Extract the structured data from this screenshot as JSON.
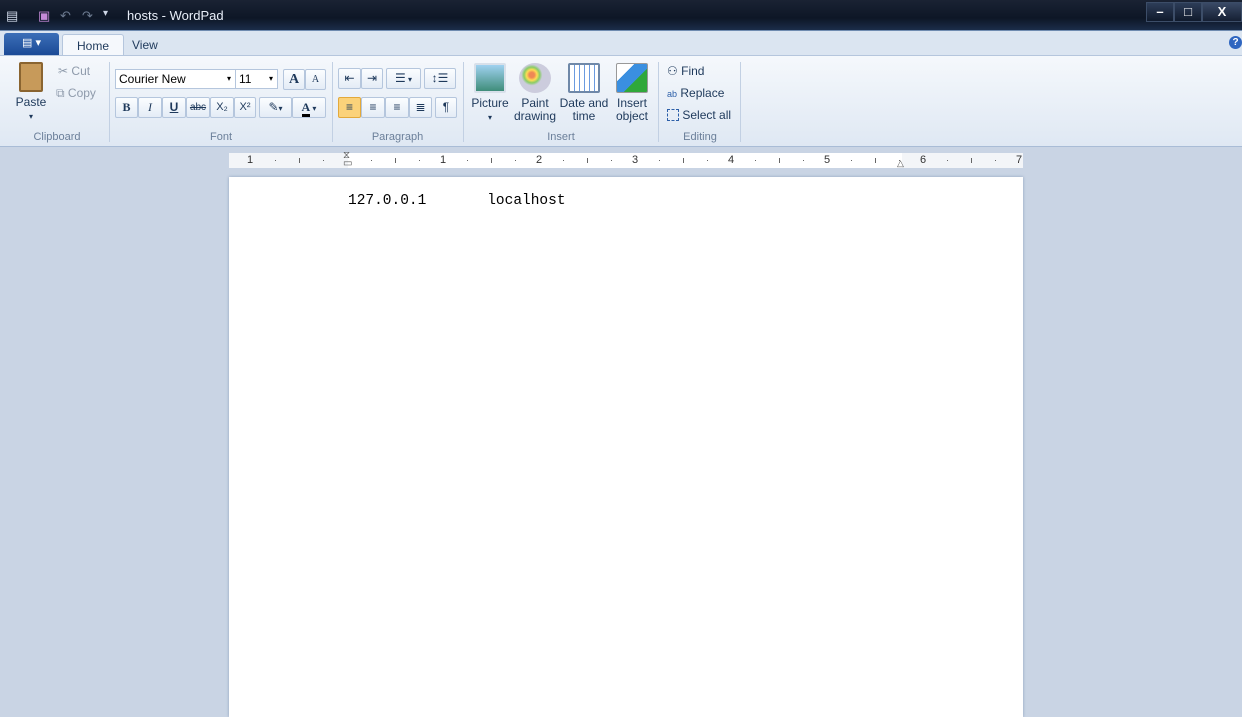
{
  "window": {
    "title": "hosts - WordPad",
    "minimize": "–",
    "maximize": "□",
    "close": "X"
  },
  "tabs": [
    {
      "label": "Home",
      "active": true
    },
    {
      "label": "View",
      "active": false
    }
  ],
  "clipboard": {
    "paste": "Paste",
    "cut": "Cut",
    "copy": "Copy",
    "label": "Clipboard"
  },
  "font": {
    "family": "Courier New",
    "size": "11",
    "grow": "A",
    "shrink": "A",
    "bold": "B",
    "italic": "I",
    "underline": "U",
    "strike": "abc",
    "subscript": "X₂",
    "superscript": "X²",
    "color_label": "A",
    "label": "Font"
  },
  "paragraph": {
    "label": "Paragraph"
  },
  "insert": {
    "picture": "Picture",
    "paint": "Paint drawing",
    "datetime": "Date and time",
    "object": "Insert object",
    "label": "Insert"
  },
  "editing": {
    "find": "Find",
    "replace": "Replace",
    "select_all": "Select all",
    "label": "Editing"
  },
  "ruler": {
    "labels": [
      "1",
      "1",
      "2",
      "3",
      "4",
      "5",
      "6",
      "7"
    ]
  },
  "document": {
    "text": "127.0.0.1       localhost"
  },
  "colors": {
    "accent": "#1b4a96",
    "ribbon": "#dfe8f3",
    "font_color": "#000000",
    "active_align": "#fbd27a"
  }
}
